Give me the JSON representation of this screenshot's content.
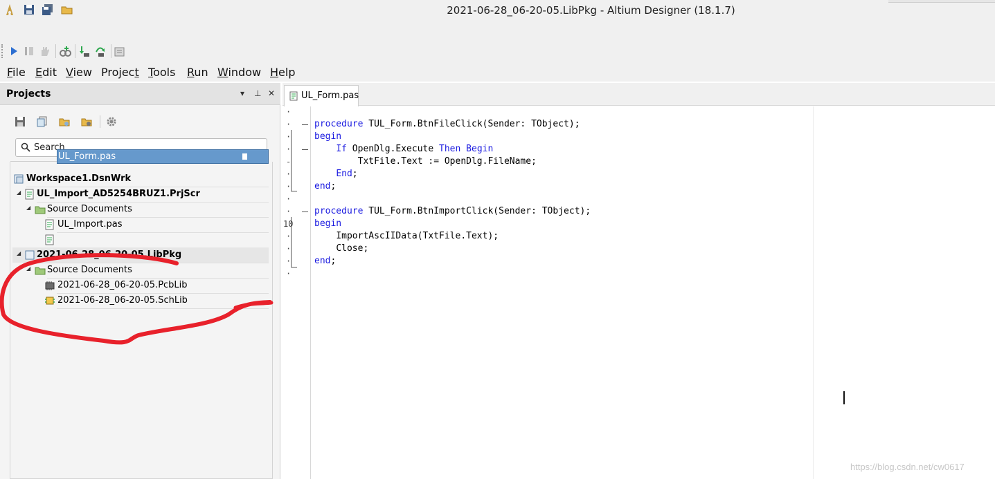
{
  "window": {
    "title": "2021-06-28_06-20-05.LibPkg - Altium Designer (18.1.7)"
  },
  "menu": [
    "File",
    "Edit",
    "View",
    "Project",
    "Tools",
    "Run",
    "Window",
    "Help"
  ],
  "menu_underline": [
    "F",
    "E",
    "V",
    "t",
    "T",
    "R",
    "W",
    "H"
  ],
  "projects_panel": {
    "title": "Projects",
    "controls": [
      "▾",
      "⊥",
      "✕"
    ],
    "search_placeholder": "Search",
    "tree": [
      {
        "label": "Workspace1.DsnWrk",
        "icon": "workspace-icon",
        "bold": true
      },
      {
        "label": "UL_Import_AD5254BRUZ1.PrjScr",
        "icon": "script-project-icon",
        "bold": true
      },
      {
        "label": "Source Documents",
        "icon": "folder-icon",
        "bold": false
      },
      {
        "label": "UL_Import.pas",
        "icon": "pascal-file-icon",
        "bold": false
      },
      {
        "label": "UL_Form.pas",
        "icon": "pascal-file-icon",
        "bold": false,
        "selected": true
      },
      {
        "label": "2021-06-28_06-20-05.LibPkg",
        "icon": "library-package-icon",
        "bold": true
      },
      {
        "label": "Source Documents",
        "icon": "folder-icon",
        "bold": false
      },
      {
        "label": "2021-06-28_06-20-05.PcbLib",
        "icon": "pcb-library-icon",
        "bold": false
      },
      {
        "label": "2021-06-28_06-20-05.SchLib",
        "icon": "schematic-library-icon",
        "bold": false
      }
    ]
  },
  "editor": {
    "tab_label": "UL_Form.pas",
    "line_number_10": "10",
    "lines": [
      {
        "kw1": "procedure",
        "rest": " TUL_Form.BtnFileClick(Sender: TObject);",
        "indent": ""
      },
      {
        "kw1": "begin",
        "rest": "",
        "indent": ""
      },
      {
        "kw1": "If",
        "rest": " OpenDlg.Execute ",
        "kw2": "Then Begin",
        "indent": "    "
      },
      {
        "kw1": "",
        "rest": "TxtFile.Text := OpenDlg.FileName;",
        "indent": "        "
      },
      {
        "kw1": "End",
        "rest": ";",
        "indent": "    "
      },
      {
        "kw1": "end",
        "rest": ";",
        "indent": ""
      },
      {
        "kw1": "",
        "rest": "",
        "indent": ""
      },
      {
        "kw1": "procedure",
        "rest": " TUL_Form.BtnImportClick(Sender: TObject);",
        "indent": ""
      },
      {
        "kw1": "begin",
        "rest": "",
        "indent": ""
      },
      {
        "kw1": "",
        "rest": "ImportAscIIData(TxtFile.Text);",
        "indent": "    "
      },
      {
        "kw1": "",
        "rest": "Close;",
        "indent": "    "
      },
      {
        "kw1": "end",
        "rest": ";",
        "indent": ""
      }
    ]
  },
  "watermark": "https://blog.csdn.net/cw0617",
  "colors": {
    "keyword": "#1a1ae0",
    "selection": "#6699cc",
    "annotation": "#e8212b"
  }
}
